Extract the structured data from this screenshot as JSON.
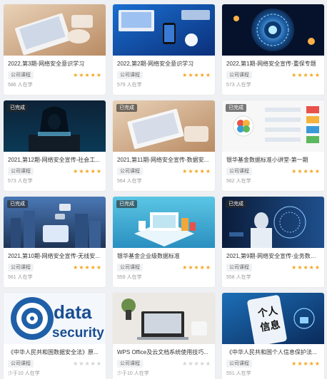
{
  "colors": {
    "star": "#f4a622",
    "star_empty": "#cfd2d6",
    "badge_bg": "#333333"
  },
  "courses": [
    {
      "title": "2022,第3期-网络安全意识学习",
      "tag": "公司课程",
      "rating": 5,
      "learners": "586 人在学",
      "badge": ""
    },
    {
      "title": "2022,第2期-网络安全意识学习",
      "tag": "公司课程",
      "rating": 5,
      "learners": "579 人在学",
      "badge": ""
    },
    {
      "title": "2022,第1期-网络安全宣传-重保专题",
      "tag": "公司课程",
      "rating": 5,
      "learners": "573 人在学",
      "badge": ""
    },
    {
      "title": "2021,第12期-网络安全宣传-社会工...",
      "tag": "公司课程",
      "rating": 5,
      "learners": "573 人在学",
      "badge": "已完成"
    },
    {
      "title": "2021,第11期-网络安全宣传-数据安...",
      "tag": "公司课程",
      "rating": 5,
      "learners": "564 人在学",
      "badge": "已完成"
    },
    {
      "title": "银华基金数据标准小讲堂-第一期",
      "tag": "公司课程",
      "rating": 5,
      "learners": "562 人在学",
      "badge": "已完成"
    },
    {
      "title": "2021,第10期-网络安全宣传-无线安...",
      "tag": "公司课程",
      "rating": 5,
      "learners": "561 人在学",
      "badge": "已完成"
    },
    {
      "title": "银华基金企业级数据标准",
      "tag": "公司课程",
      "rating": 5,
      "learners": "559 人在学",
      "badge": "已完成"
    },
    {
      "title": "2021,第9期-网络安全宣传-业务数据...",
      "tag": "公司课程",
      "rating": 5,
      "learners": "558 人在学",
      "badge": "已完成"
    },
    {
      "title": "《中华人民共和国数据安全法》原...",
      "tag": "公司课程",
      "rating": 0,
      "learners": "少于10 人在学",
      "badge": "",
      "thumb_text": [
        "data",
        "security"
      ]
    },
    {
      "title": "WPS Office及云文档系统使用技巧...",
      "tag": "公司课程",
      "rating": 0,
      "learners": "少于10 人在学",
      "badge": ""
    },
    {
      "title": "《中华人民共和国个人信息保护法...",
      "tag": "公司课程",
      "rating": 5,
      "learners": "551 人在学",
      "badge": "",
      "thumb_text": [
        "个人",
        "信息"
      ]
    }
  ]
}
